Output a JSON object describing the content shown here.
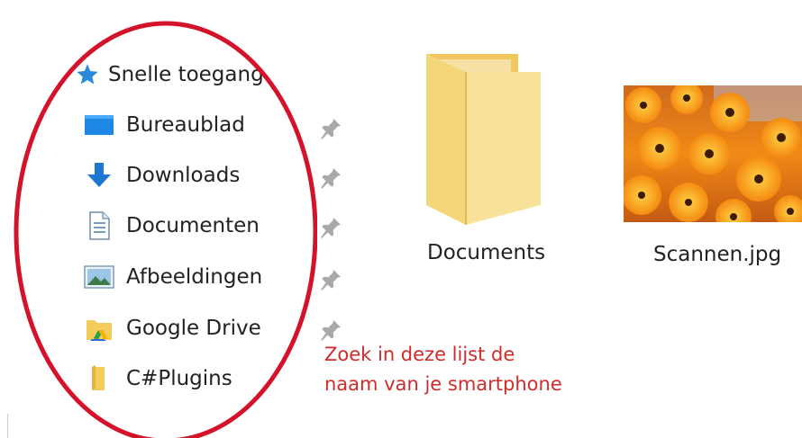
{
  "sidebar": {
    "quick_access": {
      "label": "Snelle toegang",
      "icon": "star-icon"
    },
    "items": [
      {
        "label": "Bureaublad",
        "icon": "desktop-icon",
        "pinned": true
      },
      {
        "label": "Downloads",
        "icon": "download-arrow-icon",
        "pinned": true
      },
      {
        "label": "Documenten",
        "icon": "document-icon",
        "pinned": true
      },
      {
        "label": "Afbeeldingen",
        "icon": "picture-icon",
        "pinned": true
      },
      {
        "label": "Google Drive",
        "icon": "google-drive-folder-icon",
        "pinned": true
      },
      {
        "label": "C#Plugins",
        "icon": "folder-icon",
        "pinned": false
      }
    ]
  },
  "files": [
    {
      "name": "Documents",
      "type": "folder"
    },
    {
      "name": "Scannen.jpg",
      "type": "image"
    }
  ],
  "annotation": {
    "line1": "Zoek in deze lijst de",
    "line2": "naam van je smartphone",
    "color": "#d12b2b"
  },
  "colors": {
    "highlight_ellipse": "#d4122a",
    "folder": "#f5d77a",
    "accent_blue": "#1e88e5"
  }
}
